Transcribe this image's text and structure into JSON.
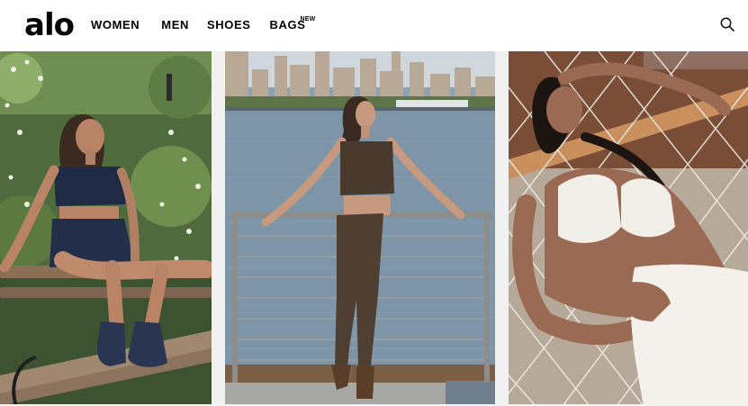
{
  "brand": {
    "logo_text": "alo"
  },
  "nav": {
    "items": [
      {
        "label": "WOMEN"
      },
      {
        "label": "MEN"
      },
      {
        "label": "SHOES"
      },
      {
        "label": "BAGS",
        "badge": "NEW"
      }
    ]
  },
  "icons": {
    "search": "search-icon"
  },
  "panels": [
    {
      "name": "garden-bench-navy-set"
    },
    {
      "name": "waterfront-espresso-set"
    },
    {
      "name": "hammock-ivory-set"
    }
  ],
  "colors": {
    "header_bg": "#ffffff",
    "text": "#000000",
    "navy": "#1f2a44",
    "espresso": "#4a3a2e",
    "ivory": "#f2efe8"
  }
}
